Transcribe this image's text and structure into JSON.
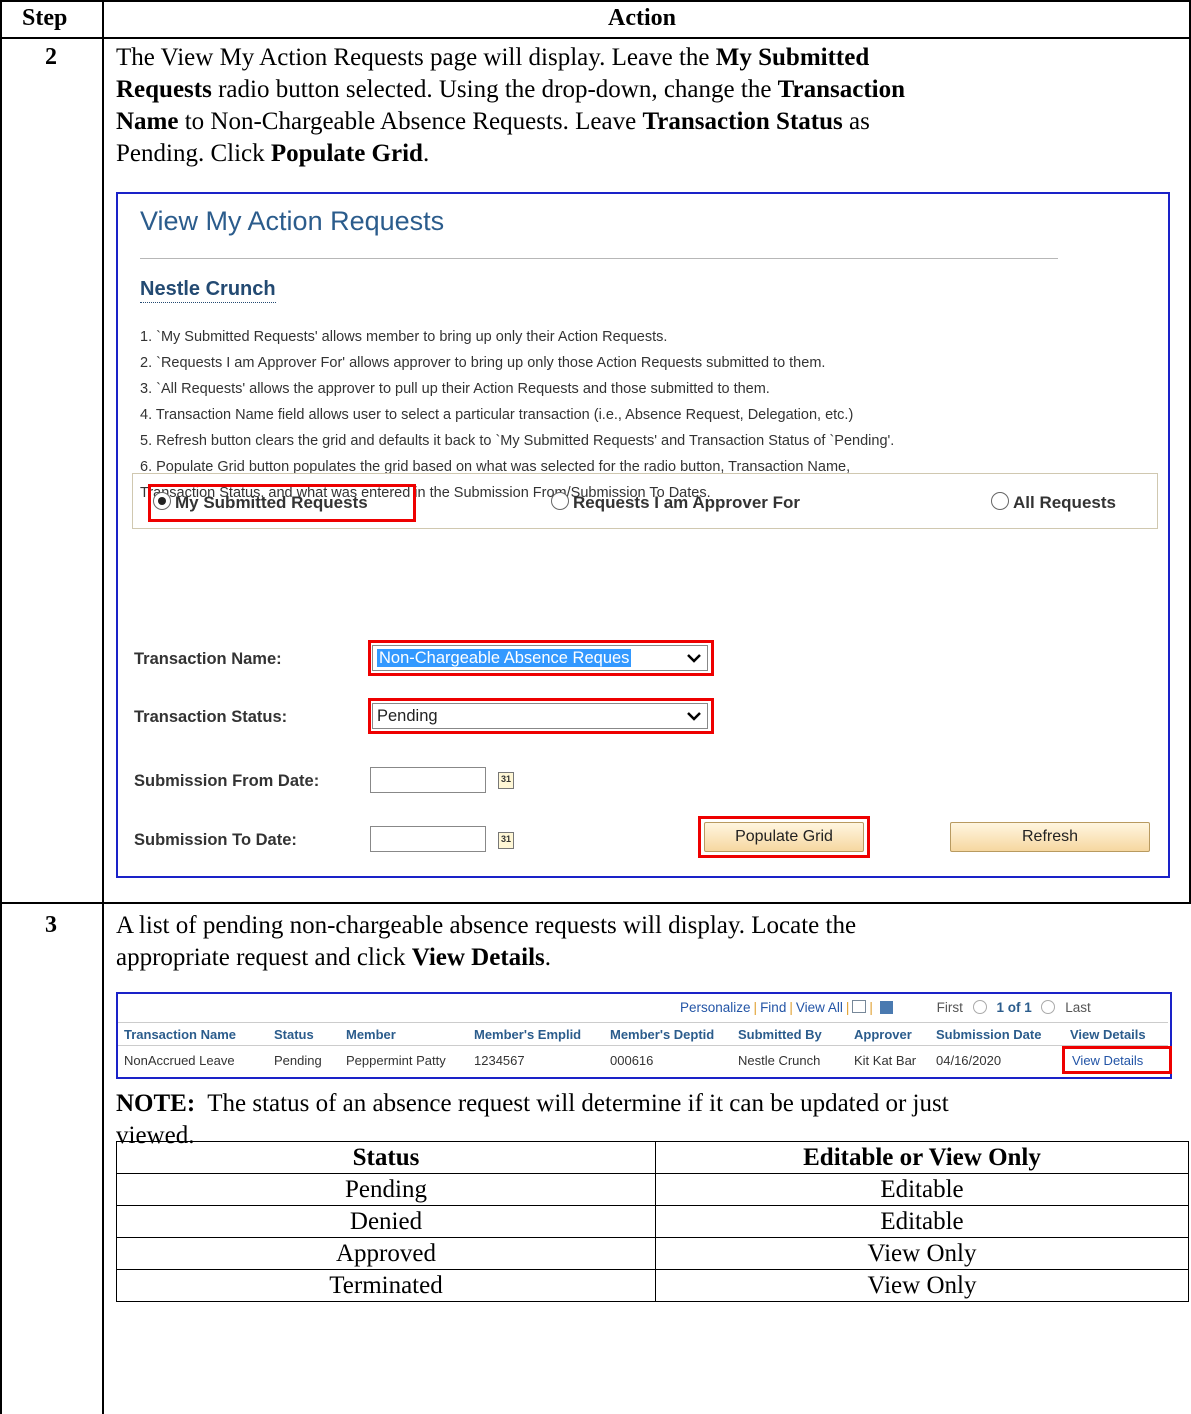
{
  "header": {
    "step": "Step",
    "action": "Action"
  },
  "step2": {
    "number": "2",
    "text_parts": [
      "The View My Action Requests page will display. Leave the ",
      "My Submitted Requests",
      " radio button selected. Using the drop-down, change the ",
      "Transaction Name",
      " to Non-Chargeable Absence Requests. Leave ",
      "Transaction Status",
      " as Pending. Click ",
      "Populate Grid",
      "."
    ],
    "line1": "The View My Action Requests page will display. Leave the",
    "line1b": "My Submitted",
    "line2b": "Requests",
    "line2": "radio button selected. Using the drop-down, change the",
    "line2c": "Transaction",
    "line3b": "Name",
    "line3": "to Non-Chargeable Absence Requests. Leave",
    "line3c": "Transaction Status",
    "line3d": "as",
    "line4": "Pending. Click",
    "line4b": "Populate Grid",
    "line4c": "."
  },
  "screenshot": {
    "title": "View My Action Requests",
    "user_name": "Nestle Crunch",
    "instructions": [
      "1. `My Submitted Requests' allows member to bring up only their Action Requests.",
      "2. `Requests I am Approver For' allows approver to bring up only those Action Requests submitted to them.",
      "3. `All Requests' allows the approver to pull up their Action Requests and those submitted to them.",
      "4. Transaction Name field allows user to select a particular transaction (i.e., Absence Request, Delegation, etc.)",
      "5. Refresh button clears the grid and defaults it back to `My Submitted Requests' and Transaction Status of `Pending'.",
      "6. Populate Grid button populates the grid based on what was selected for the radio button, Transaction Name,",
      "Transaction Status, and what was entered in the Submission From/Submission To Dates."
    ],
    "radios": [
      {
        "label": "My Submitted Requests",
        "selected": true
      },
      {
        "label": "Requests I am Approver For",
        "selected": false
      },
      {
        "label": "All Requests",
        "selected": false
      }
    ],
    "transaction_name_label": "Transaction Name:",
    "transaction_name_value": "Non-Chargeable Absence Reques",
    "transaction_status_label": "Transaction Status:",
    "transaction_status_value": "Pending",
    "submission_from_label": "Submission From Date:",
    "submission_to_label": "Submission To Date:",
    "submission_from_value": "",
    "submission_to_value": "",
    "calendar_glyph": "31",
    "populate_grid_button": "Populate Grid",
    "refresh_button": "Refresh",
    "highlight_color": "#e00000",
    "frame_color": "#1a22c8"
  },
  "step3": {
    "number": "3",
    "line1": "A list of pending non-chargeable absence requests will display. Locate the",
    "line2": "appropriate request and click",
    "line2b": "View Details",
    "line2c": "."
  },
  "grid": {
    "nav": {
      "personalize": "Personalize",
      "find": "Find",
      "view_all": "View All",
      "first": "First",
      "range": "1 of 1",
      "last": "Last"
    },
    "columns": [
      "Transaction Name",
      "Status",
      "Member",
      "Member's Emplid",
      "Member's Deptid",
      "Submitted By",
      "Approver",
      "Submission Date",
      "View Details"
    ],
    "row": [
      "NonAccrued Leave",
      "Pending",
      "Peppermint Patty",
      "1234567",
      "000616",
      "Nestle Crunch",
      "Kit Kat Bar",
      "04/16/2020",
      "View Details"
    ]
  },
  "note": {
    "label": "NOTE:",
    "line1": "The status of an absence request will determine if it can be updated or just",
    "line2": "viewed."
  },
  "status_table": {
    "headers": [
      "Status",
      "Editable or View Only"
    ],
    "rows": [
      [
        "Pending",
        "Editable"
      ],
      [
        "Denied",
        "Editable"
      ],
      [
        "Approved",
        "View Only"
      ],
      [
        "Terminated",
        "View Only"
      ]
    ]
  }
}
